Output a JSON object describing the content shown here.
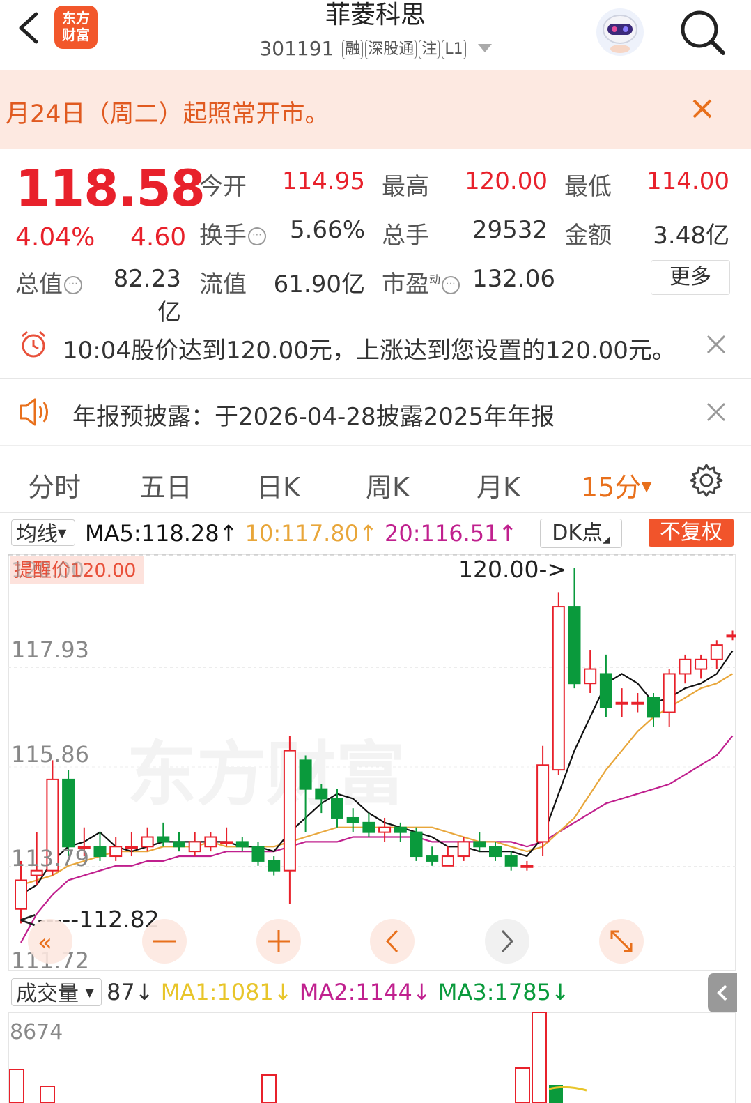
{
  "header": {
    "stock_name": "菲菱科思",
    "code": "301191",
    "tags": [
      "融",
      "深股通",
      "注",
      "L1"
    ],
    "logo_line1": "东方",
    "logo_line2": "财富"
  },
  "notice": {
    "text": "月24日（周二）起照常开市。"
  },
  "quote": {
    "price": "118.58",
    "change_pct": "4.04%",
    "change": "4.60",
    "open_label": "今开",
    "open": "114.95",
    "high_label": "最高",
    "high": "120.00",
    "low_label": "最低",
    "low": "114.00",
    "turnover_label": "换手",
    "turnover": "5.66%",
    "total_hands_label": "总手",
    "total_hands": "29532",
    "amount_label": "金额",
    "amount": "3.48亿",
    "mkt_cap_label": "总值",
    "mkt_cap": "82.23亿",
    "float_cap_label": "流值",
    "float_cap": "61.90亿",
    "pe_label": "市盈",
    "pe_sup": "动",
    "pe": "132.06",
    "more_label": "更多"
  },
  "alerts": {
    "price_alert": "10:04股价达到120.00元，上涨达到您设置的120.00元。",
    "report_alert": "年报预披露：于2026-04-28披露2025年年报"
  },
  "tabs": [
    "分时",
    "五日",
    "日K",
    "周K",
    "月K",
    "15分"
  ],
  "ma": {
    "select_label": "均线",
    "ma5": "MA5:118.28",
    "ma10": "10:117.80",
    "ma20": "20:116.51",
    "dk_label": "DK点",
    "fq_label": "不复权",
    "colors": {
      "ma5": "#111111",
      "ma10": "#e8a63a",
      "ma20": "#c0208e"
    }
  },
  "kline": {
    "alert_price_label": "提醒价120.00",
    "top_label": "120.00",
    "high_marker": "120.00->",
    "low_marker": "<-----112.82",
    "y_ticks": [
      "117.93",
      "115.86",
      "113.79",
      "111.72"
    ],
    "watermark": "东方财富"
  },
  "chart_data": {
    "type": "candlestick",
    "ylim": [
      111.72,
      120.0
    ],
    "y_ticks": [
      117.93,
      115.86,
      113.79,
      111.72
    ],
    "candles": [
      {
        "o": 112.9,
        "c": 113.5,
        "h": 113.9,
        "l": 112.6
      },
      {
        "o": 113.6,
        "c": 113.7,
        "h": 114.5,
        "l": 113.4
      },
      {
        "o": 113.7,
        "c": 115.6,
        "h": 116.0,
        "l": 113.6
      },
      {
        "o": 115.6,
        "c": 114.2,
        "h": 115.8,
        "l": 114.0
      },
      {
        "o": 114.2,
        "c": 114.2,
        "h": 114.6,
        "l": 114.0
      },
      {
        "o": 114.2,
        "c": 114.0,
        "h": 114.5,
        "l": 113.9
      },
      {
        "o": 114.0,
        "c": 114.2,
        "h": 114.4,
        "l": 113.9
      },
      {
        "o": 114.2,
        "c": 114.2,
        "h": 114.5,
        "l": 114.0
      },
      {
        "o": 114.2,
        "c": 114.4,
        "h": 114.6,
        "l": 114.1
      },
      {
        "o": 114.4,
        "c": 114.3,
        "h": 114.7,
        "l": 114.2
      },
      {
        "o": 114.3,
        "c": 114.2,
        "h": 114.5,
        "l": 114.1
      },
      {
        "o": 114.1,
        "c": 114.3,
        "h": 114.5,
        "l": 114.0
      },
      {
        "o": 114.2,
        "c": 114.4,
        "h": 114.5,
        "l": 114.1
      },
      {
        "o": 114.3,
        "c": 114.3,
        "h": 114.6,
        "l": 114.2
      },
      {
        "o": 114.3,
        "c": 114.2,
        "h": 114.4,
        "l": 114.1
      },
      {
        "o": 114.2,
        "c": 113.9,
        "h": 114.3,
        "l": 113.8
      },
      {
        "o": 113.9,
        "c": 113.7,
        "h": 114.0,
        "l": 113.6
      },
      {
        "o": 113.7,
        "c": 116.2,
        "h": 116.5,
        "l": 113.0
      },
      {
        "o": 116.0,
        "c": 115.4,
        "h": 116.1,
        "l": 114.5
      },
      {
        "o": 115.4,
        "c": 115.2,
        "h": 115.5,
        "l": 114.9
      },
      {
        "o": 115.2,
        "c": 114.8,
        "h": 115.4,
        "l": 114.6
      },
      {
        "o": 114.8,
        "c": 114.7,
        "h": 115.0,
        "l": 114.5
      },
      {
        "o": 114.7,
        "c": 114.5,
        "h": 114.9,
        "l": 114.4
      },
      {
        "o": 114.5,
        "c": 114.6,
        "h": 114.8,
        "l": 114.3
      },
      {
        "o": 114.6,
        "c": 114.5,
        "h": 114.7,
        "l": 114.3
      },
      {
        "o": 114.5,
        "c": 114.0,
        "h": 114.6,
        "l": 113.9
      },
      {
        "o": 114.0,
        "c": 113.9,
        "h": 114.2,
        "l": 113.8
      },
      {
        "o": 113.8,
        "c": 114.0,
        "h": 114.2,
        "l": 113.8
      },
      {
        "o": 114.0,
        "c": 114.3,
        "h": 114.4,
        "l": 113.9
      },
      {
        "o": 114.3,
        "c": 114.2,
        "h": 114.5,
        "l": 114.1
      },
      {
        "o": 114.2,
        "c": 114.0,
        "h": 114.3,
        "l": 113.9
      },
      {
        "o": 114.0,
        "c": 113.8,
        "h": 114.1,
        "l": 113.7
      },
      {
        "o": 113.8,
        "c": 113.8,
        "h": 113.9,
        "l": 113.7
      },
      {
        "o": 114.3,
        "c": 115.9,
        "h": 116.3,
        "l": 114.0
      },
      {
        "o": 115.8,
        "c": 119.2,
        "h": 119.5,
        "l": 115.7
      },
      {
        "o": 119.2,
        "c": 117.6,
        "h": 120.0,
        "l": 117.5
      },
      {
        "o": 117.6,
        "c": 117.9,
        "h": 118.3,
        "l": 117.4
      },
      {
        "o": 117.8,
        "c": 117.1,
        "h": 118.2,
        "l": 116.9
      },
      {
        "o": 117.2,
        "c": 117.2,
        "h": 117.5,
        "l": 116.9
      },
      {
        "o": 117.2,
        "c": 117.2,
        "h": 117.4,
        "l": 117.0
      },
      {
        "o": 117.3,
        "c": 116.9,
        "h": 117.4,
        "l": 116.7
      },
      {
        "o": 117.0,
        "c": 117.8,
        "h": 117.9,
        "l": 116.7
      },
      {
        "o": 117.8,
        "c": 118.1,
        "h": 118.2,
        "l": 117.6
      },
      {
        "o": 117.9,
        "c": 118.1,
        "h": 118.2,
        "l": 117.7
      },
      {
        "o": 118.1,
        "c": 118.4,
        "h": 118.5,
        "l": 117.9
      },
      {
        "o": 118.6,
        "c": 118.6,
        "h": 118.7,
        "l": 118.5
      }
    ],
    "ma5": [
      113.2,
      113.4,
      113.9,
      114.2,
      114.3,
      114.5,
      114.2,
      114.1,
      114.2,
      114.3,
      114.3,
      114.3,
      114.3,
      114.3,
      114.2,
      114.2,
      114.1,
      114.5,
      114.8,
      115.1,
      115.3,
      115.2,
      114.9,
      114.7,
      114.6,
      114.5,
      114.4,
      114.2,
      114.2,
      114.1,
      114.1,
      114.1,
      114.0,
      114.4,
      115.3,
      116.2,
      116.9,
      117.6,
      117.8,
      117.6,
      117.2,
      117.3,
      117.5,
      117.6,
      117.8,
      118.28
    ],
    "ma10": [
      113.4,
      113.5,
      113.6,
      113.8,
      113.9,
      114.0,
      114.1,
      114.1,
      114.1,
      114.2,
      114.2,
      114.2,
      114.3,
      114.2,
      114.2,
      114.2,
      114.2,
      114.3,
      114.4,
      114.5,
      114.6,
      114.6,
      114.6,
      114.6,
      114.6,
      114.6,
      114.6,
      114.5,
      114.4,
      114.3,
      114.3,
      114.2,
      114.1,
      114.2,
      114.5,
      114.8,
      115.3,
      115.8,
      116.2,
      116.6,
      116.9,
      117.1,
      117.3,
      117.5,
      117.6,
      117.8
    ],
    "ma20": [
      112.2,
      112.8,
      113.2,
      113.5,
      113.6,
      113.7,
      113.8,
      113.8,
      113.9,
      113.9,
      114.0,
      114.0,
      114.0,
      114.1,
      114.1,
      114.1,
      114.1,
      114.2,
      114.3,
      114.3,
      114.3,
      114.4,
      114.4,
      114.4,
      114.4,
      114.4,
      114.3,
      114.3,
      114.3,
      114.3,
      114.3,
      114.3,
      114.2,
      114.3,
      114.5,
      114.7,
      114.9,
      115.1,
      115.2,
      115.3,
      115.4,
      115.5,
      115.7,
      115.9,
      116.1,
      116.51
    ]
  },
  "volume": {
    "select_label": "成交量",
    "current": "87",
    "ma1": "MA1:1081",
    "ma2": "MA2:1144",
    "ma3": "MA3:1785",
    "top_tick": "8674",
    "colors": {
      "ma1": "#e8c52a",
      "ma2": "#c0208e",
      "ma3": "#0a9a3c"
    }
  }
}
